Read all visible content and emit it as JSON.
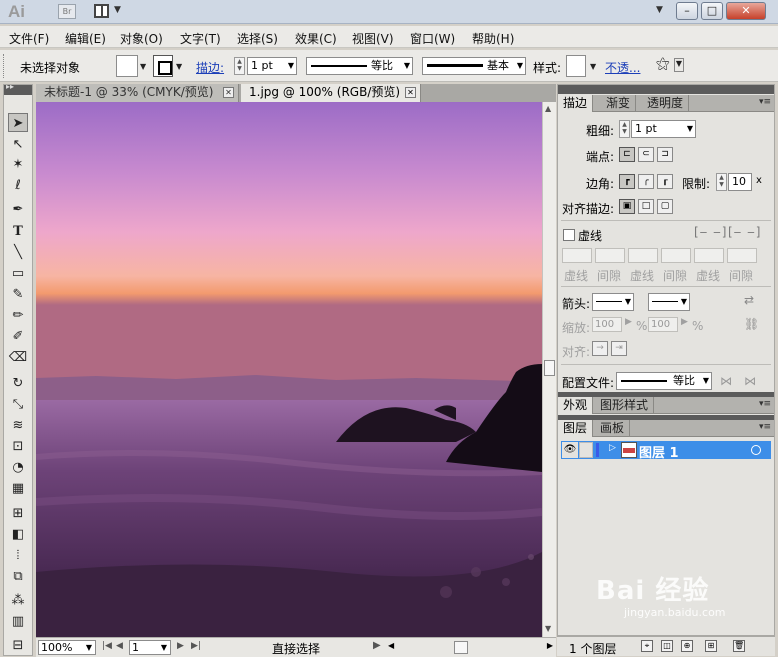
{
  "titlebar": {
    "app_logo": "Ai",
    "bridge_label": "Br",
    "window_buttons": {
      "minimize": "–",
      "maximize": "□",
      "close": "✕"
    }
  },
  "menubar": {
    "items": [
      "文件(F)",
      "编辑(E)",
      "对象(O)",
      "文字(T)",
      "选择(S)",
      "效果(C)",
      "视图(V)",
      "窗口(W)",
      "帮助(H)"
    ]
  },
  "controlbar": {
    "selection_status": "未选择对象",
    "stroke_label": "描边:",
    "stroke_weight": "1 pt",
    "uniform_label": "等比",
    "brush_label": "基本",
    "style_label": "样式:",
    "opacity_label": "不透..."
  },
  "tabs": [
    {
      "label": "未标题-1 @ 33% (CMYK/预览)",
      "active": false
    },
    {
      "label": "1.jpg @ 100% (RGB/预览)",
      "active": true
    }
  ],
  "canvas": {
    "sky_top": "#a273c9",
    "sky_mid": "#e7a2ce",
    "horizon": "#f2a977",
    "sea_dark": "#3a2240"
  },
  "statusbar": {
    "zoom": "100%",
    "page": "1",
    "current_tool": "直接选择"
  },
  "stroke_panel": {
    "tabs": [
      "描边",
      "渐变",
      "透明度"
    ],
    "weight_label": "粗细:",
    "weight_value": "1 pt",
    "cap_label": "端点:",
    "corner_label": "边角:",
    "limit_label": "限制:",
    "limit_value": "10",
    "limit_unit": "x",
    "align_label": "对齐描边:",
    "dashed_label": "虚线",
    "dash_labels": [
      "虚线",
      "间隙",
      "虚线",
      "间隙",
      "虚线",
      "间隙"
    ],
    "arrow_label": "箭头:",
    "scale_label": "缩放:",
    "scale_a": "100",
    "scale_b": "100",
    "pct": "%",
    "align_arrow_label": "对齐:",
    "profile_label": "配置文件:",
    "profile_value": "等比"
  },
  "appearance_panel": {
    "tabs": [
      "外观",
      "图形样式"
    ]
  },
  "layers_panel": {
    "tabs": [
      "图层",
      "画板"
    ],
    "layer_name": "图层 1",
    "layer_count": "1 个图层",
    "layer_color": "#3d8ee8"
  },
  "watermark": {
    "big": "Bai 经验",
    "small": "jingyan.baidu.com"
  }
}
